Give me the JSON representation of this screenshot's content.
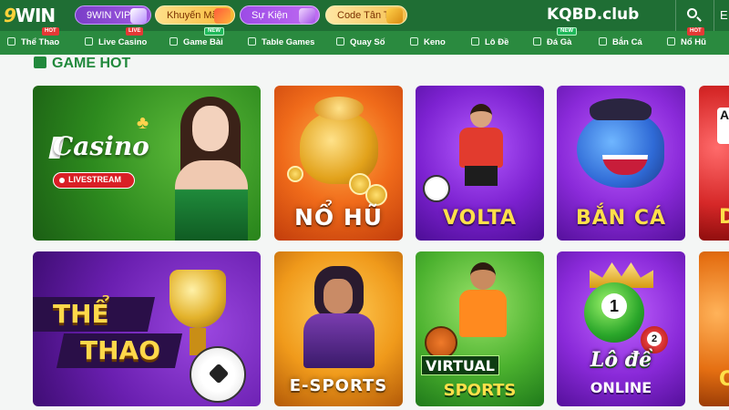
{
  "header": {
    "logo": "9WIN",
    "pills": [
      {
        "label": "9WIN VIP"
      },
      {
        "label": "Khuyến Mãi"
      },
      {
        "label": "Sự Kiện"
      },
      {
        "label": "Code Tân Thủ"
      }
    ],
    "brand": "KQBD.club",
    "extra": "E"
  },
  "nav": {
    "items": [
      {
        "label": "Thể Thao",
        "badge": "HOT"
      },
      {
        "label": "Live Casino",
        "badge": "LIVE"
      },
      {
        "label": "Game Bài",
        "badge": "NEW"
      },
      {
        "label": "Table Games"
      },
      {
        "label": "Quay Số"
      },
      {
        "label": "Keno"
      },
      {
        "label": "Lô Đề"
      },
      {
        "label": "Đá Gà",
        "badge": "NEW"
      },
      {
        "label": "Bắn Cá"
      },
      {
        "label": "Nổ Hũ",
        "badge": "HOT"
      }
    ]
  },
  "section": {
    "title": "GAME HOT"
  },
  "cards": {
    "casino": {
      "word": "Casino",
      "live": "LIVESTREAM"
    },
    "nohu": {
      "title": "NỔ HŨ"
    },
    "volta": {
      "title": "VOLTA"
    },
    "banca": {
      "title": "BẮN CÁ"
    },
    "peek1": {
      "letter": "D",
      "card": "A"
    },
    "thethao": {
      "line1": "THỂ",
      "line2": "THAO"
    },
    "esports": {
      "title": "E-SPORTS"
    },
    "virtual": {
      "line1": "VIRTUAL",
      "line2": "SPORTS"
    },
    "lode": {
      "line1": "Lô đề",
      "line2": "ONLINE",
      "ball1": "1",
      "ball2": "2"
    },
    "peek2": {
      "letter": "O"
    }
  },
  "colors": {
    "header_bg": "#1f6e34",
    "nav_bg": "#2a8a3f",
    "accent_green": "#21893c",
    "badge_hot": "#e53935",
    "badge_new": "#1fb85a"
  }
}
